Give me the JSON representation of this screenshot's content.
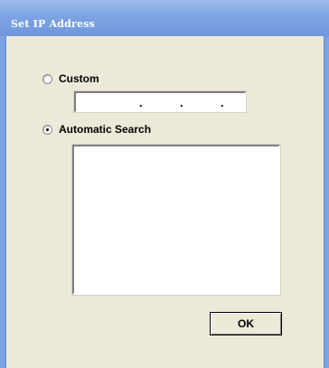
{
  "window": {
    "title": "Set IP Address"
  },
  "custom": {
    "label": "Custom",
    "checked": false,
    "ip_separators": [
      ".",
      ".",
      "."
    ]
  },
  "automatic": {
    "label": "Automatic Search",
    "checked": true
  },
  "results": {
    "items": []
  },
  "buttons": {
    "ok_label": "OK"
  },
  "colors": {
    "titlebar": "#7ea3e2",
    "background": "#ece9d8"
  }
}
